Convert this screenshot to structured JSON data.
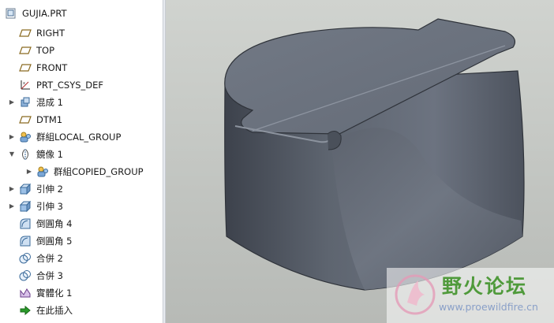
{
  "tree": {
    "items": [
      {
        "label": "GUJIA.PRT",
        "icon": "part-icon",
        "expander": ""
      },
      {
        "label": "RIGHT",
        "icon": "datum-plane-icon",
        "expander": ""
      },
      {
        "label": "TOP",
        "icon": "datum-plane-icon",
        "expander": ""
      },
      {
        "label": "FRONT",
        "icon": "datum-plane-icon",
        "expander": ""
      },
      {
        "label": "PRT_CSYS_DEF",
        "icon": "coordinate-system-icon",
        "expander": ""
      },
      {
        "label": "混成 1",
        "icon": "blend-icon",
        "expander": "▶"
      },
      {
        "label": "DTM1",
        "icon": "datum-plane-icon",
        "expander": ""
      },
      {
        "label": "群組LOCAL_GROUP",
        "icon": "group-icon",
        "expander": "▶"
      },
      {
        "label": "鏡像 1",
        "icon": "mirror-icon",
        "expander": "▼"
      },
      {
        "label": "群組COPIED_GROUP",
        "icon": "group-icon",
        "expander": "▶"
      },
      {
        "label": "引伸 2",
        "icon": "extrude-icon",
        "expander": "▶"
      },
      {
        "label": "引伸 3",
        "icon": "extrude-icon",
        "expander": "▶"
      },
      {
        "label": "倒圓角 4",
        "icon": "round-icon",
        "expander": ""
      },
      {
        "label": "倒圓角 5",
        "icon": "round-icon",
        "expander": ""
      },
      {
        "label": "合併 2",
        "icon": "merge-icon",
        "expander": ""
      },
      {
        "label": "合併 3",
        "icon": "merge-icon",
        "expander": ""
      },
      {
        "label": "實體化 1",
        "icon": "solidify-icon",
        "expander": ""
      },
      {
        "label": "在此插入",
        "icon": "insert-here-arrow-icon",
        "expander": ""
      }
    ]
  },
  "watermark": {
    "title": "野火论坛",
    "url": "www.proewildfire.cn"
  }
}
